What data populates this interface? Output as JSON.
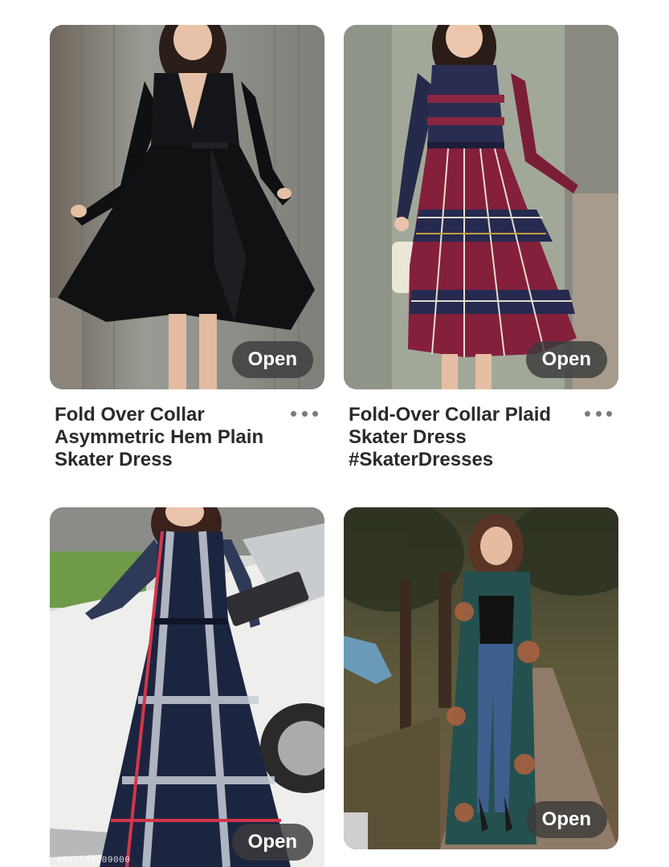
{
  "pins": [
    {
      "title": "Fold Over Collar Asymmetric Hem Plain Skater Dress",
      "open_label": "Open",
      "dress_color": "#111214",
      "background_color": "#8d8f88"
    },
    {
      "title": "Fold-Over Collar Plaid Skater Dress #SkaterDresses",
      "open_label": "Open",
      "dress_color": "#7b1e35",
      "background_color": "#9ea596"
    },
    {
      "title": "",
      "open_label": "Open",
      "dress_color": "#1d2741",
      "background_color": "#c9c9c6",
      "image_id": "4887149209000"
    },
    {
      "title": "",
      "open_label": "Open",
      "dress_color": "#27514f",
      "background_color": "#4b4a36"
    }
  ],
  "icons": {
    "more": "more-dots-icon"
  }
}
